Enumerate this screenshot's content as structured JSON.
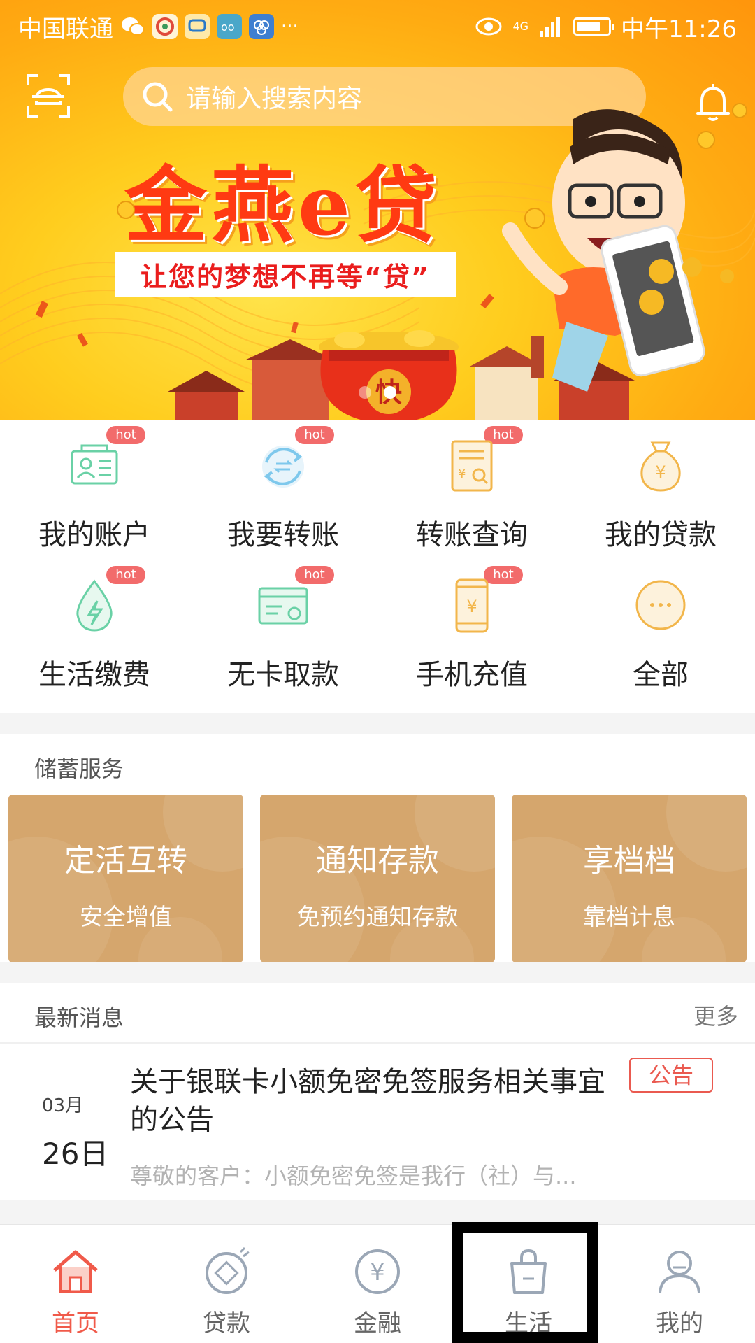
{
  "status_bar": {
    "carrier": "中国联通",
    "more": "···",
    "network": "4G",
    "time": "中午11:26"
  },
  "header": {
    "search_placeholder": "请输入搜索内容",
    "scan_icon": "scan-icon",
    "bell_icon": "bell-icon"
  },
  "banner": {
    "title": "金燕e贷",
    "subtitle": "让您的梦想不再等“贷”",
    "bag_text": "快",
    "slide_count": 2,
    "active_slide": 2
  },
  "quick_actions": [
    {
      "label": "我的账户",
      "hot": "hot",
      "icon": "id-card-icon"
    },
    {
      "label": "我要转账",
      "hot": "hot",
      "icon": "transfer-icon"
    },
    {
      "label": "转账查询",
      "hot": "hot",
      "icon": "query-icon"
    },
    {
      "label": "我的贷款",
      "hot": "",
      "icon": "loan-bag-icon"
    },
    {
      "label": "生活缴费",
      "hot": "hot",
      "icon": "utility-drop-icon"
    },
    {
      "label": "无卡取款",
      "hot": "hot",
      "icon": "cardless-icon"
    },
    {
      "label": "手机充值",
      "hot": "hot",
      "icon": "phone-recharge-icon"
    },
    {
      "label": "全部",
      "hot": "",
      "icon": "more-icon"
    }
  ],
  "savings": {
    "title": "储蓄服务",
    "cards": [
      {
        "title": "定活互转",
        "subtitle": "安全增值"
      },
      {
        "title": "通知存款",
        "subtitle": "免预约通知存款"
      },
      {
        "title": "享档档",
        "subtitle": "靠档计息"
      }
    ]
  },
  "news": {
    "title": "最新消息",
    "more": "更多",
    "item": {
      "month": "03月",
      "day": "26日",
      "title": "关于银联卡小额免密免签服务相关事宜的公告",
      "tag": "公告",
      "summary": "尊敬的客户：小额免密免签是我行（社）与..."
    }
  },
  "bottom_nav": [
    {
      "label": "首页",
      "icon": "home-icon",
      "active": true
    },
    {
      "label": "贷款",
      "icon": "loan-icon",
      "active": false
    },
    {
      "label": "金融",
      "icon": "finance-icon",
      "active": false
    },
    {
      "label": "生活",
      "icon": "shopping-bag-icon",
      "active": false
    },
    {
      "label": "我的",
      "icon": "profile-icon",
      "active": false
    }
  ],
  "colors": {
    "accent": "#f05a4a",
    "banner": "#ffab12",
    "savings_card": "#d5a66d",
    "hot_badge": "#f26b6b",
    "icon_green": "#6ad1a6",
    "icon_blue": "#7ec8ec",
    "icon_orange": "#f2b64b"
  }
}
